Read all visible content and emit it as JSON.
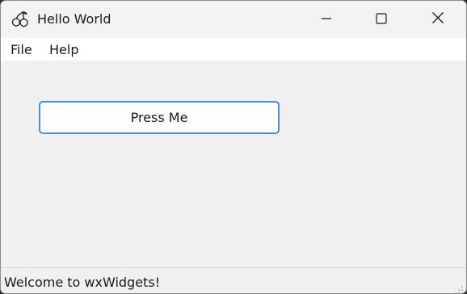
{
  "window": {
    "title": "Hello World",
    "app_icon": "cherries-icon"
  },
  "caption_buttons": {
    "minimize": "minimize-icon",
    "maximize": "maximize-icon",
    "close": "close-icon"
  },
  "menubar": {
    "items": [
      {
        "label": "File"
      },
      {
        "label": "Help"
      }
    ]
  },
  "main": {
    "button_label": "Press Me"
  },
  "statusbar": {
    "text": "Welcome to wxWidgets!"
  },
  "colors": {
    "button_border": "#4a8fd4",
    "background": "#f0f0f0",
    "menubar": "#ffffff"
  }
}
